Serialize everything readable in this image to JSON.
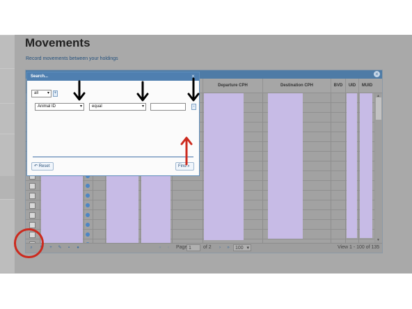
{
  "page": {
    "title": "Movements",
    "subtitle": "Record movements between your holdings"
  },
  "grid": {
    "columns": [
      "Departure CPH",
      "Destination CPH",
      "BVD",
      "UID",
      "MUID"
    ],
    "pager": {
      "page_label": "Page",
      "page_value": "1",
      "of_pages": "of 2",
      "rows_per_page": "100",
      "view_text": "View 1 - 100 of 135"
    }
  },
  "search_dialog": {
    "title": "Search...",
    "group_op": "all",
    "add_symbol": "+",
    "remove_symbol": "-",
    "field": "Animal ID",
    "operator": "equal",
    "value": "",
    "reset_label": "Reset",
    "find_label": "Find"
  },
  "colors": {
    "header_blue": "#4f7fb0",
    "highlight_purple": "#c7bbe6",
    "arrow_black": "#000000",
    "arrow_red": "#cc2a1e"
  },
  "icons": [
    "search-icon",
    "refresh-icon",
    "add-icon",
    "edit-icon",
    "delete-icon",
    "info-icon",
    "close-icon",
    "chevron-down-icon",
    "magnifier-icon",
    "reset-icon"
  ]
}
